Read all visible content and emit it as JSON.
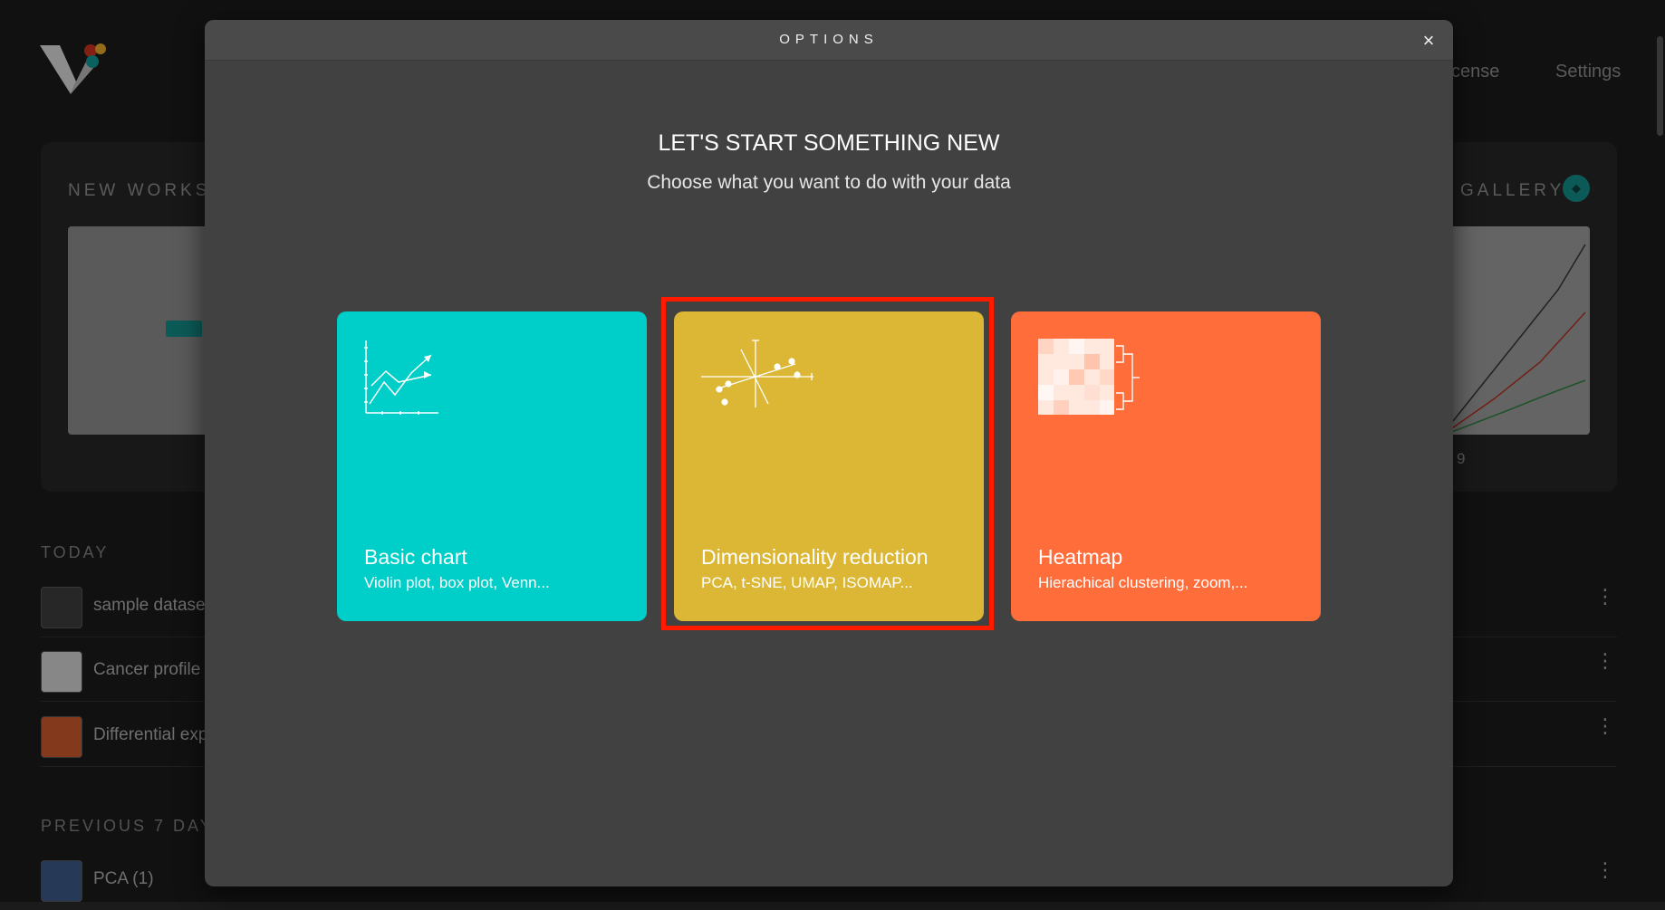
{
  "background": {
    "nav": {
      "license_partial": "cense",
      "settings": "Settings"
    },
    "new_worksheet_heading": "NEW WORKSE",
    "gallery_heading": "GALLERY",
    "gallery_caption_partial": "9",
    "today_heading": "TODAY",
    "previous_heading": "PREVIOUS 7 DAYS",
    "today_items": [
      {
        "label": "sample datase"
      },
      {
        "label": "Cancer profile"
      },
      {
        "label": "Differential exp"
      }
    ],
    "previous_items": [
      {
        "label": "PCA (1)"
      }
    ]
  },
  "modal": {
    "title": "OPTIONS",
    "close_label": "×",
    "heading": "LET'S START SOMETHING NEW",
    "subheading": "Choose what you want to do with your data",
    "cards": [
      {
        "title": "Basic chart",
        "description": "Violin plot, box plot, Venn...",
        "color": "#00cec8",
        "icon": "line-chart-icon"
      },
      {
        "title": "Dimensionality reduction",
        "description": "PCA, t-SNE, UMAP, ISOMAP...",
        "color": "#dbb735",
        "icon": "scatter-axes-icon"
      },
      {
        "title": "Heatmap",
        "description": "Hierachical clustering, zoom,...",
        "color": "#ff6d3b",
        "icon": "heatmap-dendrogram-icon"
      }
    ],
    "highlighted_card": "Dimensionality reduction",
    "highlight_color": "#ff1a00"
  }
}
